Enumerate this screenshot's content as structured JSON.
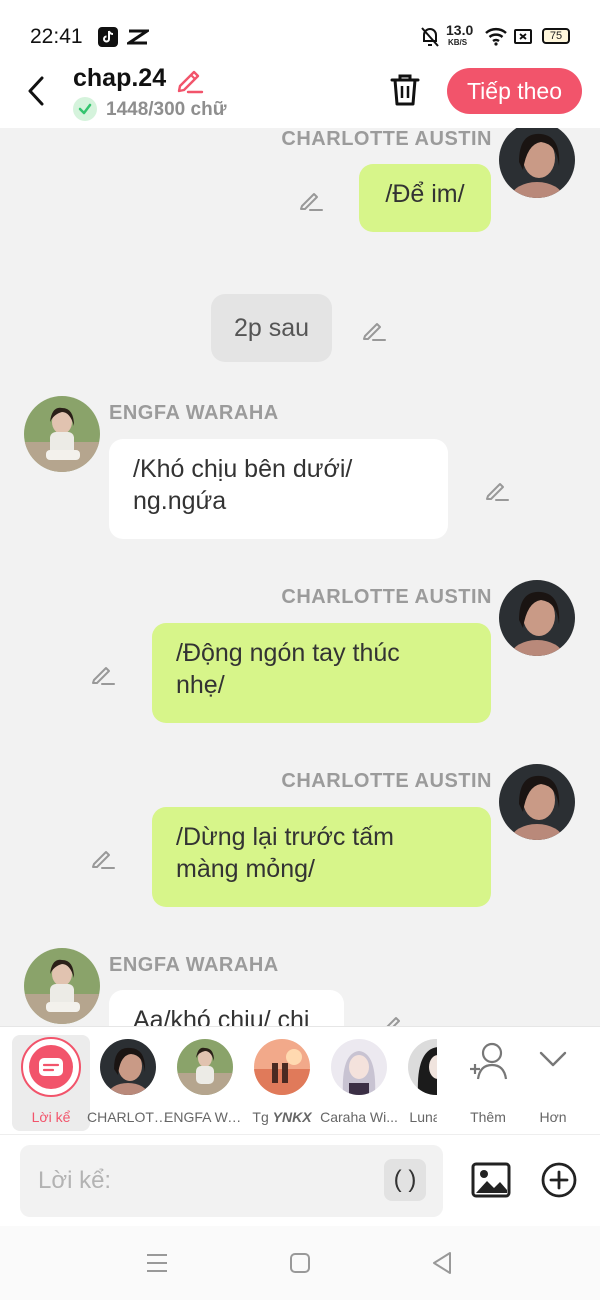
{
  "status": {
    "time": "22:41",
    "net_speed_value": "13.0",
    "net_speed_unit": "KB/S",
    "battery": "75"
  },
  "header": {
    "title": "chap.24",
    "word_count": "1448/300 chữ",
    "next_label": "Tiếp theo",
    "accent_color": "#f2546b"
  },
  "chat": {
    "messages": [
      {
        "speaker": "CHARLOTTE AUSTIN",
        "text": "/Để im/"
      },
      {
        "text": "2p sau"
      },
      {
        "speaker": "ENGFA WARAHA",
        "line1": "/Khó chịu bên dưới/",
        "line2": "ng.ngứa"
      },
      {
        "speaker": "CHARLOTTE AUSTIN",
        "line1": "/Động ngón tay thúc",
        "line2": "nhẹ/"
      },
      {
        "speaker": "CHARLOTTE AUSTIN",
        "line1": "/Dừng lại trước tấm",
        "line2": "màng mỏng/"
      },
      {
        "speaker": "ENGFA WARAHA",
        "text": "Aa/khó chịu/ chị"
      }
    ]
  },
  "characters": {
    "items": [
      {
        "label": "Lời kể"
      },
      {
        "label": "CHARLOTTE AUSTIN"
      },
      {
        "label": "ENGFA WARAHA"
      },
      {
        "label_prefix": "Tg ",
        "label_bold": "YNKX"
      },
      {
        "label": "Caraha Wi..."
      },
      {
        "label": "Luna"
      }
    ],
    "add_label": "Thêm",
    "more_label": "Hơn"
  },
  "composer": {
    "placeholder": "Lời kể:",
    "paren_label": "( )"
  },
  "colors": {
    "green_bubble": "#d7f58a",
    "accent": "#f2546b",
    "check_green": "#34c46e"
  }
}
